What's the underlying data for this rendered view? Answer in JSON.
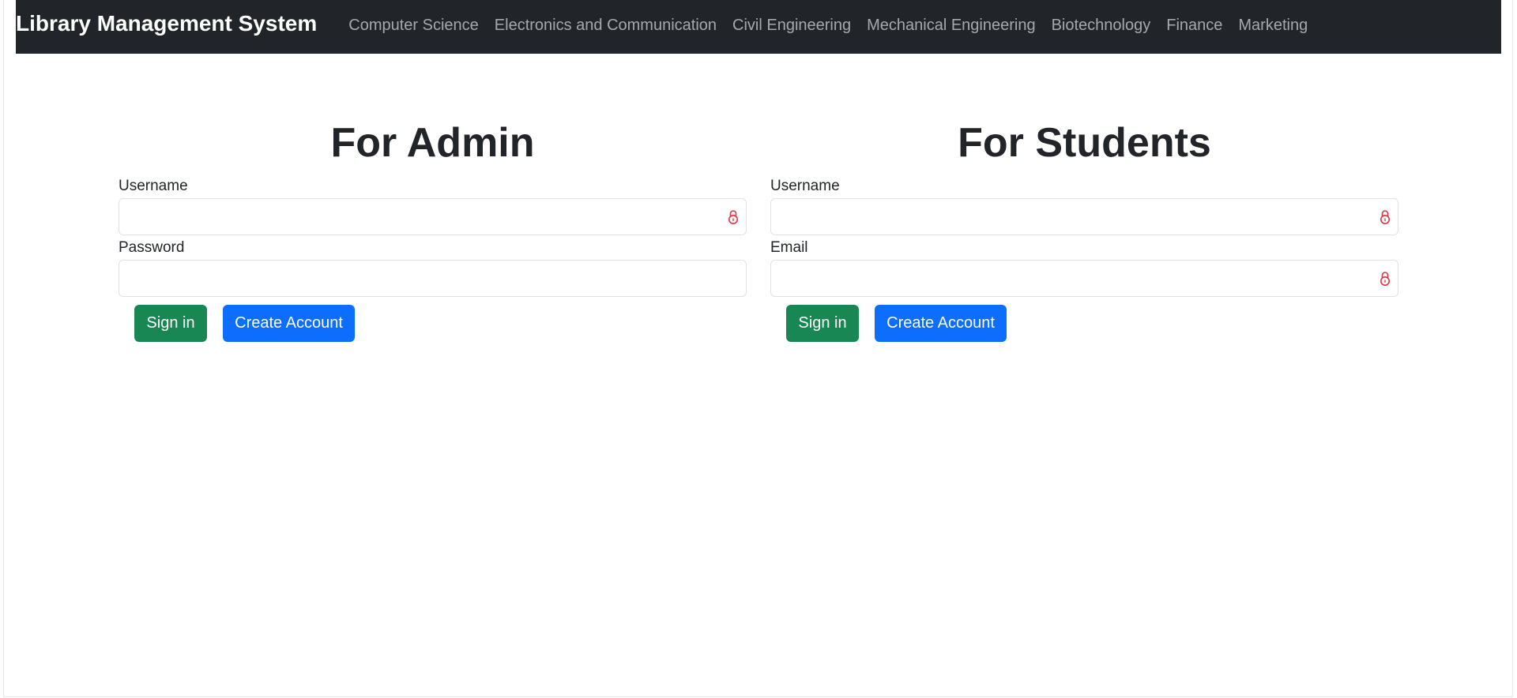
{
  "navbar": {
    "brand": "Library Management System",
    "links": [
      "Computer Science",
      "Electronics and Communication",
      "Civil Engineering",
      "Mechanical Engineering",
      "Biotechnology",
      "Finance",
      "Marketing"
    ]
  },
  "admin": {
    "title": "For Admin",
    "username_label": "Username",
    "password_label": "Password",
    "signin_label": "Sign in",
    "create_label": "Create Account"
  },
  "students": {
    "title": "For Students",
    "username_label": "Username",
    "email_label": "Email",
    "signin_label": "Sign in",
    "create_label": "Create Account"
  },
  "colors": {
    "navbar_bg": "#212529",
    "sign_in": "#198754",
    "create_account": "#0d6efd",
    "lock_icon": "#dc3545"
  }
}
